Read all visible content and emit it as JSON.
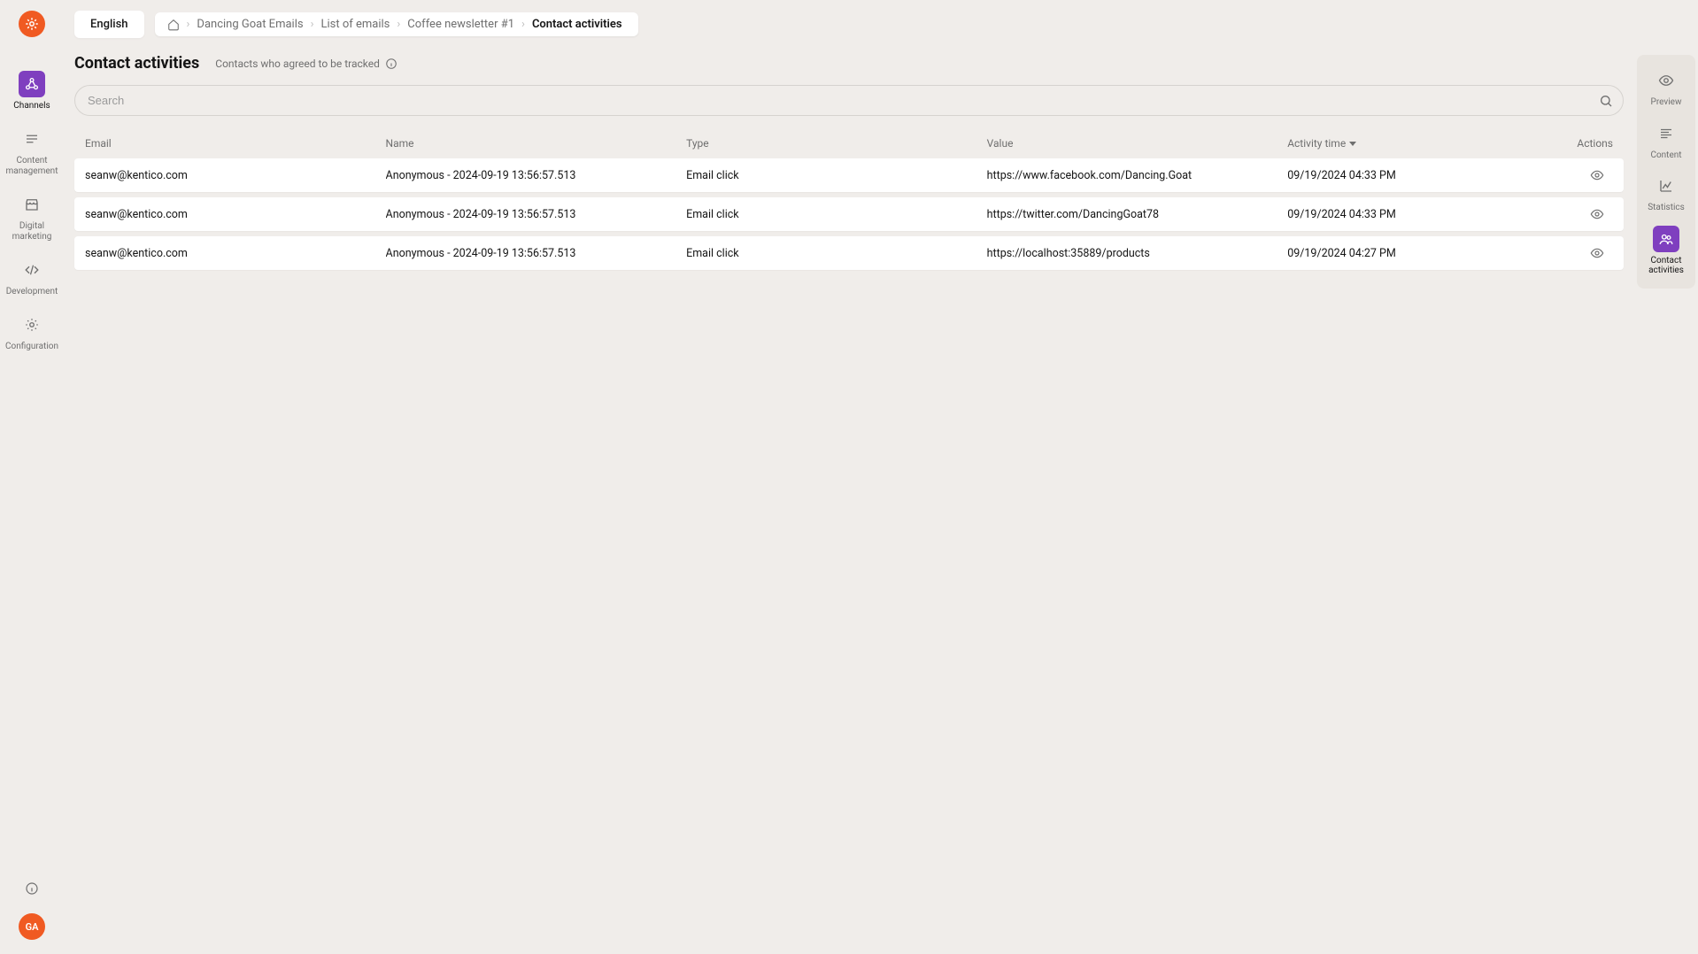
{
  "colors": {
    "accent": "#7f3fbf",
    "brand": "#f05a22"
  },
  "header": {
    "language": "English",
    "breadcrumb": {
      "items": [
        "Dancing Goat Emails",
        "List of emails",
        "Coffee newsletter #1"
      ],
      "current": "Contact activities"
    }
  },
  "page": {
    "title": "Contact activities",
    "subtitle": "Contacts who agreed to be tracked"
  },
  "search": {
    "placeholder": "Search",
    "value": ""
  },
  "left_nav": [
    {
      "label": "Channels",
      "icon": "share",
      "active": true
    },
    {
      "label": "Content management",
      "icon": "stack",
      "active": false
    },
    {
      "label": "Digital marketing",
      "icon": "store",
      "active": false
    },
    {
      "label": "Development",
      "icon": "code",
      "active": false
    },
    {
      "label": "Configuration",
      "icon": "gear",
      "active": false
    }
  ],
  "right_nav": [
    {
      "label": "Preview",
      "icon": "eye",
      "active": false
    },
    {
      "label": "Content",
      "icon": "align",
      "active": false
    },
    {
      "label": "Statistics",
      "icon": "chart",
      "active": false
    },
    {
      "label": "Contact activities",
      "icon": "users",
      "active": true
    }
  ],
  "avatar": {
    "initials": "GA"
  },
  "table": {
    "columns": [
      "Email",
      "Name",
      "Type",
      "Value",
      "Activity time",
      "Actions"
    ],
    "sort_column": "Activity time",
    "rows": [
      {
        "email": "seanw@kentico.com",
        "name": "Anonymous - 2024-09-19 13:56:57.513",
        "type": "Email click",
        "value": "https://www.facebook.com/Dancing.Goat",
        "time": "09/19/2024 04:33 PM"
      },
      {
        "email": "seanw@kentico.com",
        "name": "Anonymous - 2024-09-19 13:56:57.513",
        "type": "Email click",
        "value": "https://twitter.com/DancingGoat78",
        "time": "09/19/2024 04:33 PM"
      },
      {
        "email": "seanw@kentico.com",
        "name": "Anonymous - 2024-09-19 13:56:57.513",
        "type": "Email click",
        "value": "https://localhost:35889/products",
        "time": "09/19/2024 04:27 PM"
      }
    ]
  }
}
